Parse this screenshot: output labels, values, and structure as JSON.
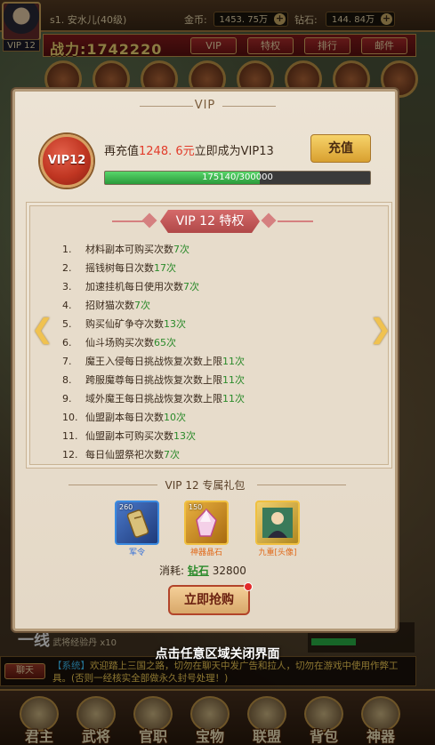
{
  "topbar": {
    "avatar_vip": "VIP 12",
    "player_name": "s1. 安水儿(40级)",
    "gold_label": "金币:",
    "gold_value": "1453. 75万",
    "diamond_label": "钻石:",
    "diamond_value": "144. 84万",
    "power": "战力:1742220",
    "buttons": [
      "VIP",
      "特权",
      "排行",
      "邮件"
    ]
  },
  "panel": {
    "title": "VIP",
    "badge": "VIP12",
    "recharge_prefix": "再充值",
    "recharge_amount": "1248. 6元",
    "recharge_suffix": "立即成为VIP13",
    "recharge_button": "充值",
    "progress_text": "175140/300000",
    "progress_ratio": 0.5838,
    "privileges_header": "VIP 12 特权",
    "privileges": [
      {
        "num": "1.",
        "text": "材料副本可购买次数",
        "value": "7次"
      },
      {
        "num": "2.",
        "text": "摇钱树每日次数",
        "value": "17次"
      },
      {
        "num": "3.",
        "text": "加速挂机每日使用次数",
        "value": "7次"
      },
      {
        "num": "4.",
        "text": "招财猫次数",
        "value": "7次"
      },
      {
        "num": "5.",
        "text": "购买仙矿争夺次数",
        "value": "13次"
      },
      {
        "num": "6.",
        "text": "仙斗场购买次数",
        "value": "65次"
      },
      {
        "num": "7.",
        "text": "魔王入侵每日挑战恢复次数上限",
        "value": "11次"
      },
      {
        "num": "8.",
        "text": "跨服魔尊每日挑战恢复次数上限",
        "value": "11次"
      },
      {
        "num": "9.",
        "text": "域外魔王每日挑战恢复次数上限",
        "value": "11次"
      },
      {
        "num": "10.",
        "text": "仙盟副本每日次数",
        "value": "10次"
      },
      {
        "num": "11.",
        "text": "仙盟副本可购买次数",
        "value": "13次"
      },
      {
        "num": "12.",
        "text": "每日仙盟祭祀次数",
        "value": "7次"
      }
    ],
    "gift_title": "VIP 12 专属礼包",
    "gifts": [
      {
        "count": "260",
        "label": "军令",
        "label_color": "#2a6ad8",
        "icon": "command-token-icon"
      },
      {
        "count": "150",
        "label": "神器晶石",
        "label_color": "#e06a1a",
        "icon": "artifact-crystal-icon"
      },
      {
        "count": "",
        "label": "九重[头像]",
        "label_color": "#e06a1a",
        "icon": "portrait-frame-icon"
      }
    ],
    "cost_label": "消耗:",
    "cost_currency": "钻石",
    "cost_value": "32800",
    "buy_button": "立即抢购"
  },
  "close_hint": "点击任意区域关闭界面",
  "behind": {
    "left_big": "一线",
    "left_text": "武将经验丹 x10"
  },
  "chat": {
    "tag": "聊天",
    "system": "【系统】",
    "message": "欢迎踏上三国之路，切勿在聊天中发广告和拉人，切勿在游戏中使用作弊工具。(否则一经核实全部做永久封号处理！)"
  },
  "bottom_nav": [
    "君主",
    "武将",
    "官职",
    "宝物",
    "联盟",
    "背包",
    "神器"
  ]
}
